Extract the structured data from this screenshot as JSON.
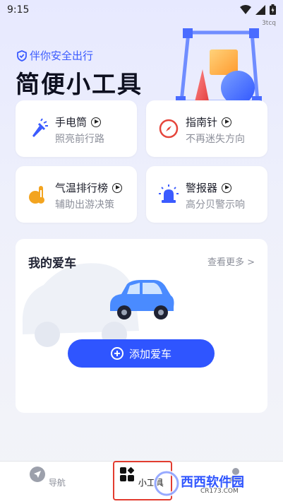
{
  "status": {
    "time": "9:15",
    "tag": "3tcq"
  },
  "header": {
    "slogan": "伴你安全出行",
    "title": "简便小工具"
  },
  "tools": [
    {
      "name": "手电筒",
      "desc": "照亮前行路",
      "icon": "flashlight-icon"
    },
    {
      "name": "指南针",
      "desc": "不再迷失方向",
      "icon": "compass-icon"
    },
    {
      "name": "气温排行榜",
      "desc": "辅助出游决策",
      "icon": "thermometer-icon"
    },
    {
      "name": "警报器",
      "desc": "高分贝警示响",
      "icon": "siren-icon"
    }
  ],
  "car": {
    "title": "我的爱车",
    "view_more": "查看更多 >",
    "add_label": "添加爱车"
  },
  "nav": [
    {
      "label": "导航",
      "icon": "navigation-icon"
    },
    {
      "label": "小工具",
      "icon": "tools-icon"
    },
    {
      "label": "",
      "icon": "profile-icon"
    }
  ],
  "watermark": {
    "brand": "西西软件园",
    "site": "CR173.COM"
  },
  "colors": {
    "accent": "#2f55ff",
    "highlight": "#e23c2f"
  }
}
